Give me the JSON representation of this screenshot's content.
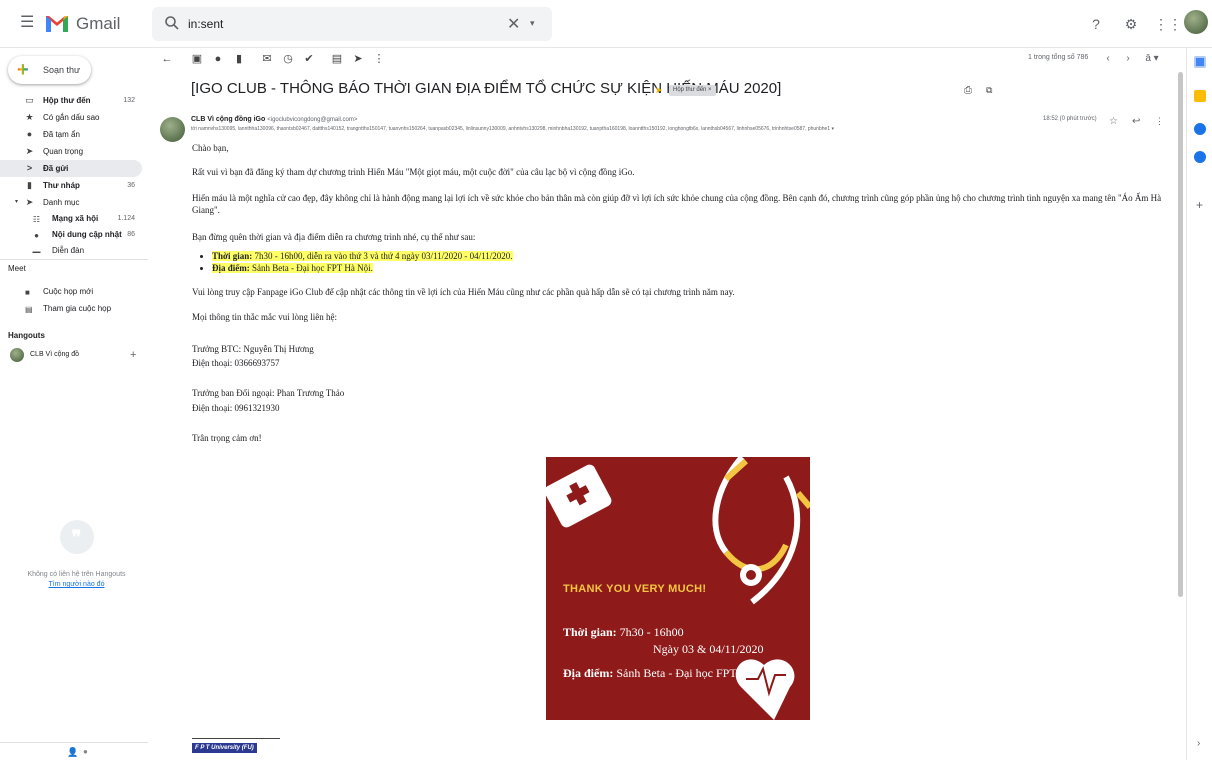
{
  "app": {
    "name": "Gmail"
  },
  "search": {
    "value": "in:sent"
  },
  "colors": {
    "poster_bg": "#8e1b1a",
    "poster_accent": "#f4c542",
    "highlight": "#ffff66"
  },
  "sidebar": {
    "compose_label": "Soạn thư",
    "items": [
      {
        "icon": "inbox-icon",
        "label": "Hộp thư đến",
        "count": "132"
      },
      {
        "icon": "star-icon",
        "label": "Có gắn dấu sao",
        "count": ""
      },
      {
        "icon": "clock-icon",
        "label": "Đã tạm ẩn",
        "count": ""
      },
      {
        "icon": "important-icon",
        "label": "Quan trọng",
        "count": ""
      },
      {
        "icon": "send-icon",
        "label": "Đã gửi",
        "count": ""
      },
      {
        "icon": "draft-icon",
        "label": "Thư nháp",
        "count": "36"
      },
      {
        "icon": "label-icon",
        "label": "Danh mục",
        "count": ""
      }
    ],
    "categories": [
      {
        "icon": "people-icon",
        "label": "Mạng xã hội",
        "count": "1.124"
      },
      {
        "icon": "info-icon",
        "label": "Nội dung cập nhật",
        "count": "86"
      },
      {
        "icon": "forum-icon",
        "label": "Diễn đàn",
        "count": ""
      }
    ],
    "meet": {
      "title": "Meet",
      "items": [
        {
          "icon": "video-icon",
          "label": "Cuộc họp mới"
        },
        {
          "icon": "keyboard-icon",
          "label": "Tham gia cuộc họp"
        }
      ]
    },
    "hangouts": {
      "title": "Hangouts",
      "user": "CLB Vì cộng đồ",
      "empty_msg": "Không có liên hệ trên Hangouts",
      "find_link": "Tìm người nào đó"
    }
  },
  "toolbar": {
    "pager": "1 trong tổng số 786"
  },
  "email": {
    "subject": "[IGO CLUB - THÔNG BÁO THỜI GIAN ĐỊA ĐIỂM TỔ CHỨC SỰ KIỆN HIẾN MÁU 2020]",
    "label_chip": "Hộp thư đến ×",
    "sender_name": "CLB Vì cộng đồng iGo",
    "sender_email": "<igoclubvicongdong@gmail.com>",
    "recipients": "tới namnvhs130095, lannthha130096, thaontsb02467, dattths140152, trangntths150147, tuanvnhs150264, tuanpasb02345, linlinsunny130009, anhntvhs130298, minhnbha130192, tuanptha160198, loanntths150192, longhongtb6x, lannthsb04567, linhnhse05676, trinhnhtse0587, phunbhe1 ▾",
    "time": "18:52 (0 phút trước)",
    "greeting": "Chào bạn,",
    "p1": "Rất vui vì bạn đã đăng ký tham dự chương trình Hiến Máu \"Một giọt máu, một cuộc đời\" của câu lạc bộ vì cộng đồng iGo.",
    "p2": "Hiến máu là một nghĩa cử cao đẹp, đây không chỉ là hành động mang lại lợi ích về sức khỏe cho bản thân mà còn giúp đỡ vì lợi ích sức khỏe chung của cộng đồng. Bên cạnh đó, chương trình cũng góp phần ủng hộ cho chương trình tình nguyện xa mang tên \"Áo Ấm Hà Giang\".",
    "p3": "Bạn đừng quên thời gian và địa điểm diễn ra chương trình nhé, cụ thể như sau:",
    "b1_label": "Thời gian:",
    "b1_text": " 7h30 - 16h00, diễn ra vào thứ 3 và thứ 4 ngày 03/11/2020 - 04/11/2020.",
    "b2_label": "Địa điểm:",
    "b2_text": " Sảnh Beta - Đại học FPT Hà Nội.",
    "p4": "Vui lòng truy cập Fanpage iGo Club để cập nhật các thông tin về lợi ích của Hiến Máu cũng như các phần quà hấp dẫn sẽ có tại chương trình năm nay.",
    "p5": "Mọi thông tin thắc mắc vui lòng liên hệ:",
    "c1_name": "Trưởng BTC: Nguyễn Thị Hương",
    "c1_phone": "Điện thoại: 0366693757",
    "c2_name": "Trưởng ban Đối ngoại: Phan Trương Thảo",
    "c2_phone": "Điện thoại: 0961321930",
    "closing": "Trân trọng cảm ơn!",
    "poster": {
      "thanks": "THANK YOU VERY MUCH!",
      "time_label": "Thời gian:",
      "time_value": " 7h30 - 16h00",
      "date": "Ngày 03 & 04/11/2020",
      "place_label": "Địa điểm:",
      "place_value": " Sảnh Beta - Đại học FPT"
    },
    "signature": "F P T University (FU)"
  }
}
